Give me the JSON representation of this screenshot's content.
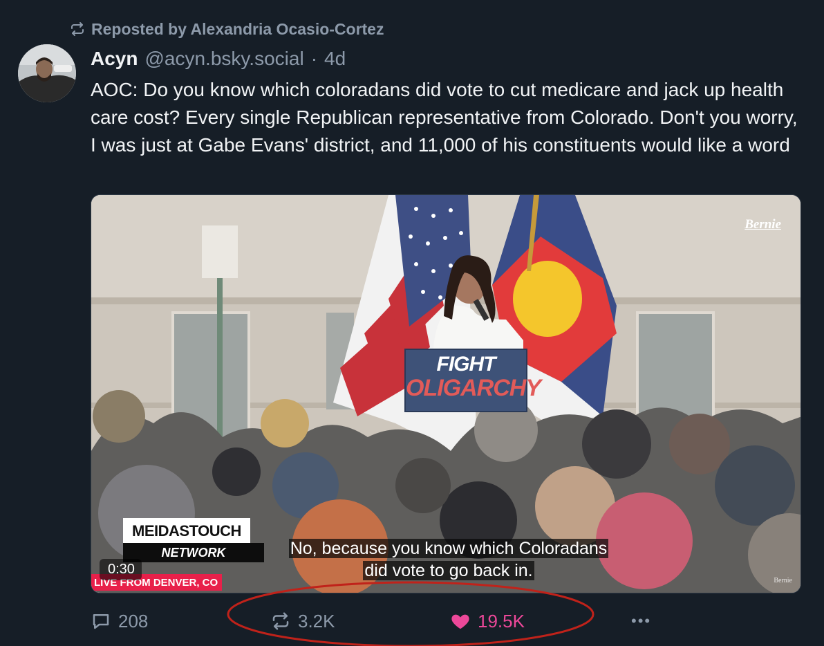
{
  "repost": {
    "icon": "repost-icon",
    "label": "Reposted by Alexandria Ocasio-Cortez"
  },
  "author": {
    "name": "Acyn",
    "handle": "@acyn.bsky.social",
    "separator": "·",
    "age": "4d"
  },
  "post": {
    "text": "AOC: Do you know which coloradans did vote to cut medicare and jack up health care cost? Every single Republican representative from Colorado. Don't you worry, I was just at Gabe Evans' district, and 11,000 of his constituents would like a word"
  },
  "video": {
    "watermark": "Bernie",
    "watermark_small": "Bernie",
    "podium_line1": "FIGHT",
    "podium_line2": "OLIGARCHY",
    "network_top": "MEIDASTOUCH",
    "network_bottom": "NETWORK",
    "live_label": "LIVE FROM DENVER, CO",
    "duration": "0:30",
    "caption_line1": "No, because you know which Coloradans",
    "caption_line2": "did vote to go back in."
  },
  "actions": {
    "reply_count": "208",
    "repost_count": "3.2K",
    "like_count": "19.5K",
    "more_label": "•••"
  },
  "colors": {
    "background": "#161e27",
    "text_primary": "#f1f3f5",
    "text_secondary": "#8d9aaa",
    "like_active": "#ec4899",
    "annotation_ellipse": "#c0221a"
  }
}
